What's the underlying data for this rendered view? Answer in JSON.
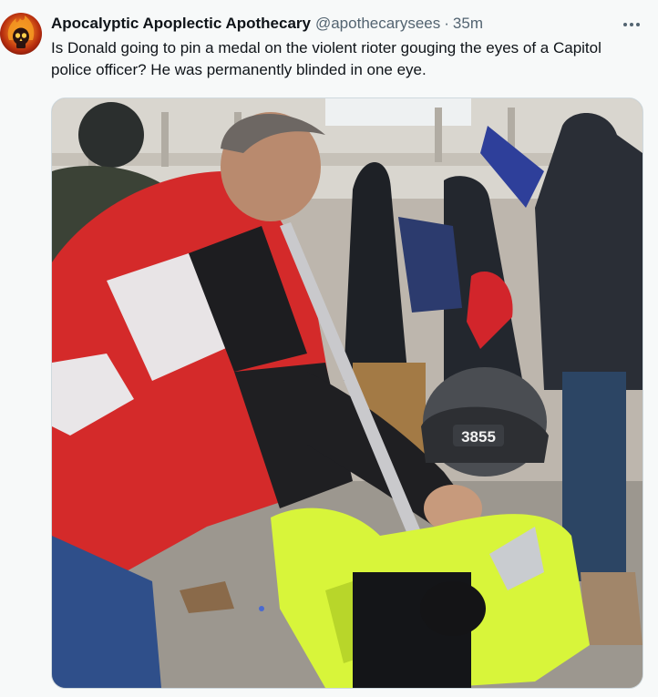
{
  "tweet": {
    "display_name": "Apocalyptic Apoplectic Apothecary",
    "handle": "@apothecarysees",
    "separator": "·",
    "time": "35m",
    "text": "Is Donald going to pin a medal on the violent rioter gouging the eyes of a Capitol police officer? He was permanently blinded in one eye.",
    "more_icon": "more-dots-icon",
    "avatar_icon": "flaming-skull-icon"
  },
  "media": {
    "helmet_number": "3855"
  },
  "colors": {
    "text_primary": "#0f1419",
    "text_secondary": "#536471",
    "background": "#f7f9f9",
    "border": "#cfd9de",
    "hi_vis_yellow": "#d8f53a",
    "jacket_red": "#d42a2a"
  }
}
